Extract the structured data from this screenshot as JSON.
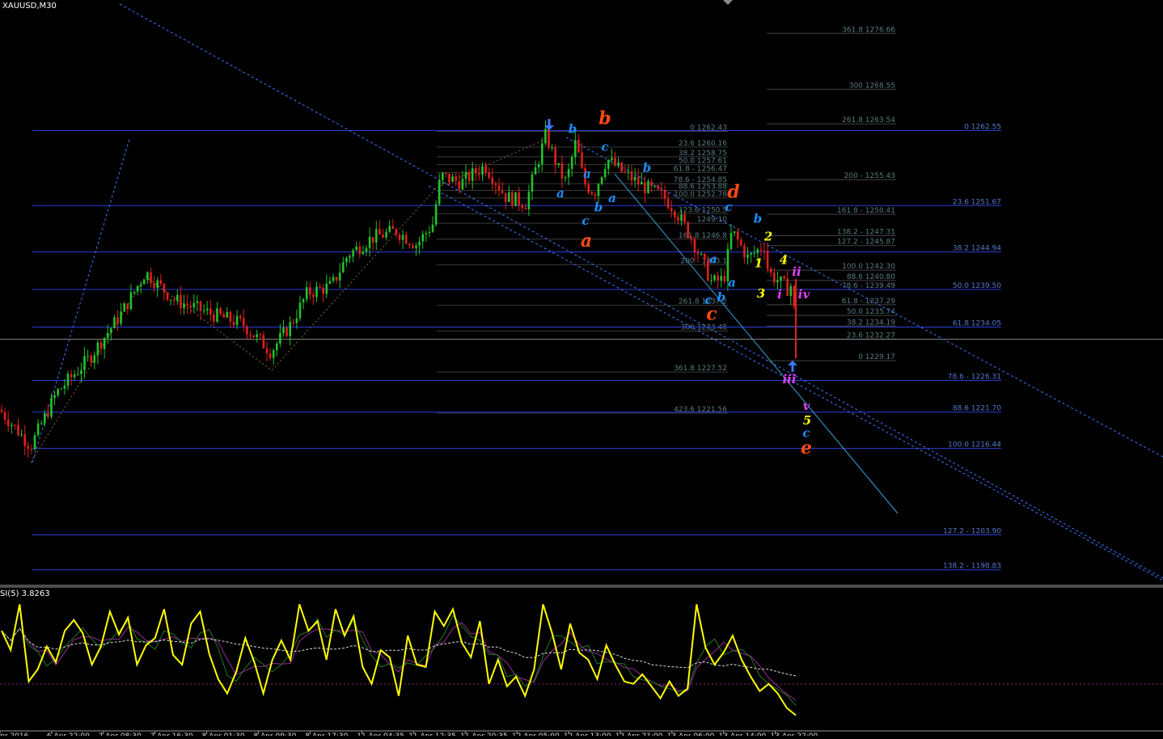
{
  "chart_title": "XAUUSD,M30",
  "colors": {
    "background": "#000000",
    "bull_candle": "#22c22a",
    "bear_candle": "#e0201c",
    "level_line": "#2c3dd8",
    "fib_line": "#3a3a3a",
    "fib_text": "#5a7a82",
    "level_text": "#5577cc",
    "trend_line": "#3c78ff",
    "channel_line": "#3aa0d8",
    "indicator_main": "#ffff00",
    "indicator_green": "#1f7a1f",
    "indicator_purple": "#9a2a9a",
    "indicator_signal": "#dddddd",
    "indicator_level": "#8a2a6a"
  },
  "chart_data": [
    {
      "type": "candlestick",
      "symbol": "XAUUSD",
      "timeframe": "M30",
      "ylim": [
        1196.8,
        1281.5
      ],
      "x_tick_labels": [
        "Apr 2016",
        "6 Apr 22:00",
        "7 Apr 08:30",
        "7 Apr 16:30",
        "8 Apr 01:30",
        "8 Apr 09:30",
        "8 Apr 17:30",
        "11 Apr 04:35",
        "11 Apr 12:35",
        "11 Apr 20:35",
        "12 Apr 05:00",
        "12 Apr 13:00",
        "12 Apr 21:00",
        "13 Apr 06:00",
        "13 Apr 14:00",
        "13 Apr 22:00"
      ],
      "price_path": [
        [
          0,
          1222
        ],
        [
          38,
          1216.8
        ],
        [
          70,
          1224.5
        ],
        [
          110,
          1229.5
        ],
        [
          150,
          1236
        ],
        [
          180,
          1242
        ],
        [
          215,
          1238
        ],
        [
          260,
          1236
        ],
        [
          300,
          1234.5
        ],
        [
          335,
          1230.5
        ],
        [
          360,
          1234.5
        ],
        [
          380,
          1239
        ],
        [
          410,
          1240
        ],
        [
          430,
          1244.5
        ],
        [
          460,
          1247
        ],
        [
          490,
          1248
        ],
        [
          515,
          1246
        ],
        [
          535,
          1249
        ],
        [
          545,
          1256
        ],
        [
          570,
          1255
        ],
        [
          600,
          1257.5
        ],
        [
          625,
          1253
        ],
        [
          650,
          1252
        ],
        [
          675,
          1262
        ],
        [
          690,
          1257
        ],
        [
          700,
          1255
        ],
        [
          712,
          1261
        ],
        [
          722,
          1255
        ],
        [
          735,
          1253.5
        ],
        [
          750,
          1258.5
        ],
        [
          770,
          1256.5
        ],
        [
          795,
          1254.5
        ],
        [
          820,
          1253
        ],
        [
          835,
          1251
        ],
        [
          855,
          1247
        ],
        [
          880,
          1240.5
        ],
        [
          895,
          1241
        ],
        [
          905,
          1248
        ],
        [
          925,
          1244
        ],
        [
          945,
          1246
        ],
        [
          950,
          1242
        ],
        [
          965,
          1240.5
        ],
        [
          975,
          1239.5
        ],
        [
          980,
          1240.5
        ],
        [
          984,
          1232
        ]
      ],
      "horizontal_levels": [
        {
          "label": "0 1262.55",
          "price": 1262.55
        },
        {
          "label": "23.6 1251.67",
          "price": 1251.67
        },
        {
          "label": "38.2 1244.94",
          "price": 1244.94
        },
        {
          "label": "50.0 1239.50",
          "price": 1239.5
        },
        {
          "label": "61.8 1234.05",
          "price": 1234.05
        },
        {
          "label": "78.6 - 1226.31",
          "price": 1226.31
        },
        {
          "label": "88.6 1221.70",
          "price": 1221.7
        },
        {
          "label": "100.0 1216.44",
          "price": 1216.44
        },
        {
          "label": "127.2 - 1203.90",
          "price": 1203.9
        },
        {
          "label": "138.2 - 1198.83",
          "price": 1198.83
        }
      ],
      "fib_extension_upper": [
        {
          "label": "361.8 1276.66",
          "price": 1276.66
        },
        {
          "label": "300 1268.55",
          "price": 1268.55
        },
        {
          "label": "261.8 1263.54",
          "price": 1263.54
        },
        {
          "label": "200 - 1255.43",
          "price": 1255.43
        },
        {
          "label": "161.8 - 1250.41",
          "price": 1250.41
        },
        {
          "label": "138.2 - 1247.31",
          "price": 1247.31
        },
        {
          "label": "127.2 - 1245.87",
          "price": 1245.87
        },
        {
          "label": "100.0 1242.30",
          "price": 1242.3
        },
        {
          "label": "88.6 1240.80",
          "price": 1240.8
        },
        {
          "label": "78.6 - 1239.49",
          "price": 1239.49
        },
        {
          "label": "61.8 - 1237.29",
          "price": 1237.29
        },
        {
          "label": "50.0 1235.74",
          "price": 1235.74
        },
        {
          "label": "38.2 1234.19",
          "price": 1234.19
        },
        {
          "label": "23.6 1232.27",
          "price": 1232.27
        },
        {
          "label": "0 1229.17",
          "price": 1229.17
        }
      ],
      "fib_retracement_mid": [
        {
          "label": "0 1262.43",
          "price": 1262.43
        },
        {
          "label": "23.6 1260.16",
          "price": 1260.16
        },
        {
          "label": "38.2 1258.75",
          "price": 1258.75
        },
        {
          "label": "50.0 1257.61",
          "price": 1257.61
        },
        {
          "label": "61.8 - 1256.47",
          "price": 1256.47
        },
        {
          "label": "78.6 - 1254.85",
          "price": 1254.85
        },
        {
          "label": "88.6 1253.88",
          "price": 1253.88
        },
        {
          "label": "100.0 1252.78",
          "price": 1252.78
        },
        {
          "label": "123.6 1250.5",
          "price": 1250.5
        },
        {
          "label": "1249.10",
          "price": 1249.1
        },
        {
          "label": "161.8 1246.8",
          "price": 1246.8
        },
        {
          "label": "200 - 1243.1",
          "price": 1243.1
        },
        {
          "label": "261.8 1237.2",
          "price": 1237.2
        },
        {
          "label": "300 1233.48",
          "price": 1233.48
        },
        {
          "label": "361.8 1227.52",
          "price": 1227.52
        },
        {
          "label": "423.6 1221.56",
          "price": 1221.56
        }
      ],
      "current_price": 1232.27,
      "wave_labels": [
        {
          "text": "b",
          "color": "#1e90ff",
          "price": 1262.2,
          "x": 708
        },
        {
          "text": "b",
          "color": "#ff4a14",
          "price": 1263.5,
          "x": 748
        },
        {
          "text": "c",
          "color": "#1e90ff",
          "price": 1259.6,
          "x": 748
        },
        {
          "text": "b",
          "color": "#1e90ff",
          "price": 1256.6,
          "x": 800
        },
        {
          "text": "a",
          "color": "#1e90ff",
          "price": 1255.7,
          "x": 726
        },
        {
          "text": "a",
          "color": "#1e90ff",
          "price": 1252.9,
          "x": 693
        },
        {
          "text": "a",
          "color": "#1e90ff",
          "price": 1252.2,
          "x": 757
        },
        {
          "text": "b",
          "color": "#1e90ff",
          "price": 1250.8,
          "x": 740
        },
        {
          "text": "c",
          "color": "#1e90ff",
          "price": 1248.9,
          "x": 724
        },
        {
          "text": "a",
          "color": "#ff4a14",
          "price": 1245.7,
          "x": 725
        },
        {
          "text": "d",
          "color": "#ff4a14",
          "price": 1252.8,
          "x": 907
        },
        {
          "text": "c",
          "color": "#1e90ff",
          "price": 1250.9,
          "x": 901
        },
        {
          "text": "b",
          "color": "#1e90ff",
          "price": 1249.2,
          "x": 937
        },
        {
          "text": "2",
          "color": "#ffff00",
          "price": 1246.6,
          "x": 950
        },
        {
          "text": "a",
          "color": "#1e90ff",
          "price": 1243.3,
          "x": 882
        },
        {
          "text": "4",
          "color": "#ffff00",
          "price": 1243.2,
          "x": 969
        },
        {
          "text": "1",
          "color": "#ffff00",
          "price": 1242.7,
          "x": 938
        },
        {
          "text": "ii",
          "color": "#e040ff",
          "price": 1241.5,
          "x": 985
        },
        {
          "text": "a",
          "color": "#1e90ff",
          "price": 1239.9,
          "x": 905
        },
        {
          "text": "b",
          "color": "#1e90ff",
          "price": 1237.8,
          "x": 892
        },
        {
          "text": "3",
          "color": "#ffff00",
          "price": 1238.3,
          "x": 941
        },
        {
          "text": "i",
          "color": "#e040ff",
          "price": 1238.2,
          "x": 964
        },
        {
          "text": "iv",
          "color": "#e040ff",
          "price": 1238.2,
          "x": 994
        },
        {
          "text": "c",
          "color": "#1e90ff",
          "price": 1237.4,
          "x": 876
        },
        {
          "text": "c",
          "color": "#ff4a14",
          "price": 1235.1,
          "x": 880
        },
        {
          "text": "iii",
          "color": "#e040ff",
          "price": 1225.9,
          "x": 976
        },
        {
          "text": "v",
          "color": "#e040ff",
          "price": 1222.0,
          "x": 997
        },
        {
          "text": "5",
          "color": "#ffff00",
          "price": 1219.9,
          "x": 998
        },
        {
          "text": "c",
          "color": "#1e90ff",
          "price": 1218.1,
          "x": 997
        },
        {
          "text": "e",
          "color": "#ff4a14",
          "price": 1215.7,
          "x": 997
        }
      ],
      "arrows": [
        {
          "direction": "down",
          "price": 1262.6,
          "x": 679,
          "color": "#3c78ff"
        },
        {
          "direction": "up",
          "price": 1229.2,
          "x": 980,
          "color": "#3c78ff"
        }
      ]
    },
    {
      "type": "line",
      "indicator_label": "SI(5) 3.8263",
      "ylim": [
        -5,
        105
      ],
      "reference_level": 30,
      "series_main": [
        74,
        58,
        96,
        32,
        42,
        61,
        48,
        74,
        83,
        72,
        46,
        61,
        90,
        71,
        85,
        46,
        62,
        68,
        92,
        54,
        46,
        80,
        90,
        55,
        34,
        22,
        40,
        68,
        48,
        22,
        50,
        66,
        50,
        96,
        74,
        82,
        50,
        92,
        70,
        86,
        44,
        30,
        58,
        52,
        20,
        70,
        46,
        44,
        90,
        78,
        92,
        64,
        52,
        82,
        30,
        50,
        28,
        36,
        20,
        42,
        96,
        72,
        42,
        80,
        56,
        50,
        34,
        62,
        46,
        32,
        30,
        38,
        28,
        18,
        32,
        20,
        26,
        96,
        60,
        46,
        56,
        70,
        50,
        36,
        24,
        30,
        22,
        10,
        4
      ]
    }
  ]
}
